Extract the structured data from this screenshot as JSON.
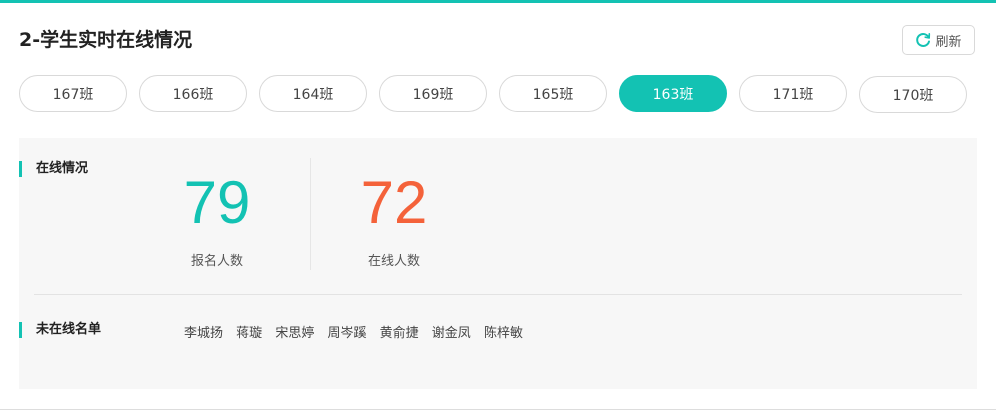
{
  "header": {
    "title": "2-学生实时在线情况",
    "refresh_label": "刷新"
  },
  "tabs": [
    {
      "label": "167班",
      "active": false
    },
    {
      "label": "166班",
      "active": false
    },
    {
      "label": "164班",
      "active": false
    },
    {
      "label": "169班",
      "active": false
    },
    {
      "label": "165班",
      "active": false
    },
    {
      "label": "163班",
      "active": true
    },
    {
      "label": "171班",
      "active": false
    },
    {
      "label": "170班",
      "active": false
    }
  ],
  "online": {
    "section_label": "在线情况",
    "enrolled": {
      "value": "79",
      "label": "报名人数",
      "color": "#13c2b3"
    },
    "online": {
      "value": "72",
      "label": "在线人数",
      "color": "#f4623a"
    }
  },
  "offline": {
    "section_label": "未在线名单",
    "names": [
      "李城扬",
      "蒋璇",
      "宋思婷",
      "周岑蹊",
      "黄俞捷",
      "谢金凤",
      "陈梓敏"
    ]
  },
  "colors": {
    "accent": "#13c2b3",
    "highlight": "#f4623a"
  }
}
